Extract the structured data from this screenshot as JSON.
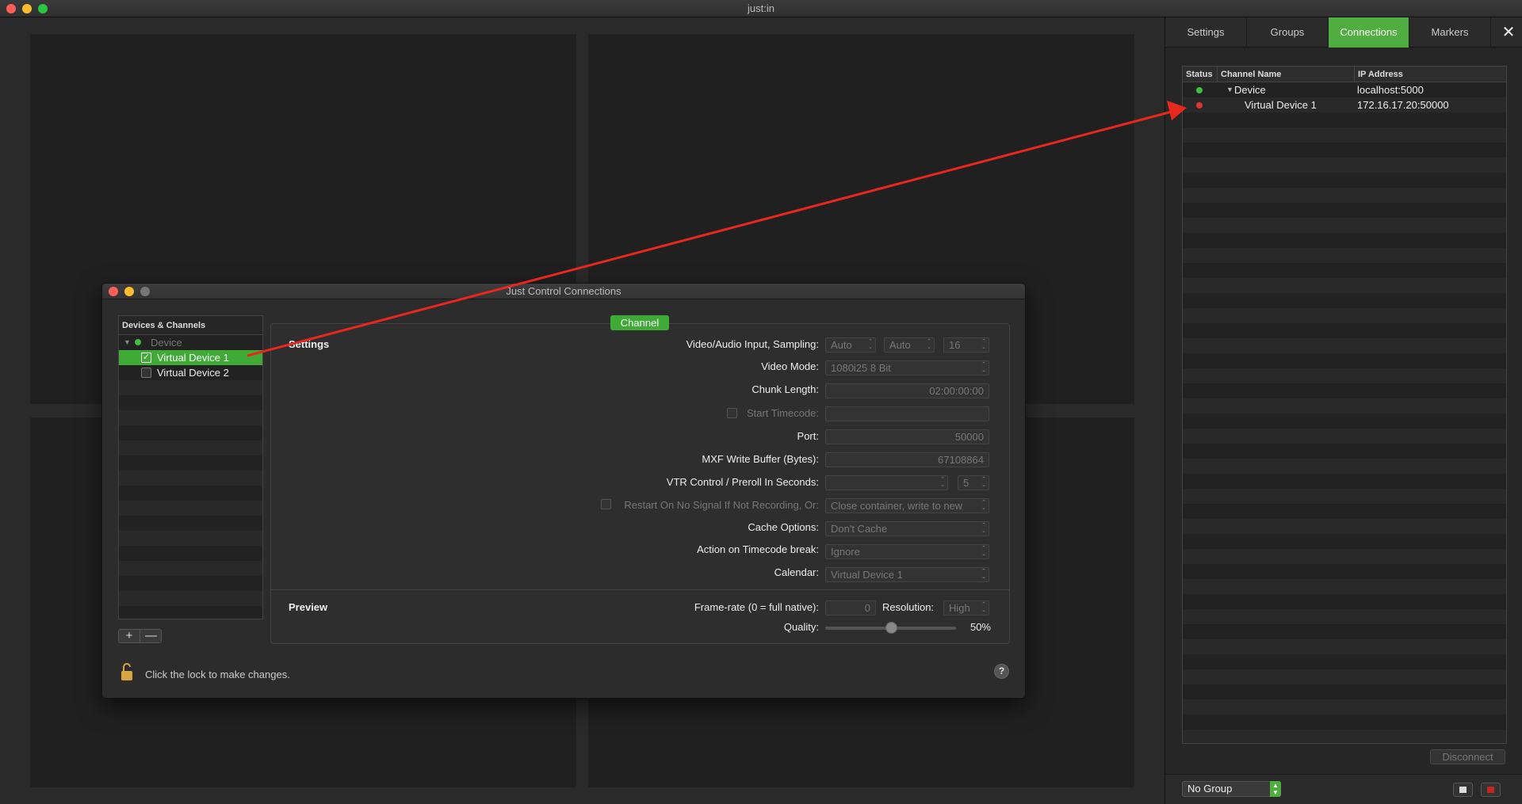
{
  "app": {
    "title": "just:in"
  },
  "side_panel": {
    "tabs": [
      {
        "label": "Settings"
      },
      {
        "label": "Groups"
      },
      {
        "label": "Connections",
        "active": true
      },
      {
        "label": "Markers"
      }
    ],
    "close_icon": "close-icon",
    "table": {
      "headers": [
        "Status",
        "Channel Name",
        "IP Address"
      ],
      "rows": [
        {
          "status": "green",
          "name": "Device",
          "ip": "localhost:5000",
          "expanded": true
        },
        {
          "status": "red",
          "name": "Virtual Device 1",
          "ip": "172.16.17.20:50000"
        }
      ]
    },
    "disconnect_label": "Disconnect",
    "group_select": "No Group"
  },
  "dialog": {
    "title": "Just Control Connections",
    "devices_header": "Devices & Channels",
    "devices": [
      {
        "label": "Device",
        "type": "group"
      },
      {
        "label": "Virtual Device 1",
        "checked": true,
        "selected": true
      },
      {
        "label": "Virtual Device 2",
        "checked": false
      }
    ],
    "add_label": "+",
    "remove_label": "—",
    "channel_tab": "Channel",
    "settings_section": "Settings",
    "preview_section": "Preview",
    "fields": {
      "video_audio_label": "Video/Audio Input, Sampling:",
      "video_audio_values": [
        "Auto",
        "Auto",
        "16"
      ],
      "video_mode_label": "Video Mode:",
      "video_mode_value": "1080i25 8 Bit",
      "chunk_length_label": "Chunk Length:",
      "chunk_length_value": "02:00:00:00",
      "start_timecode_label": "Start Timecode:",
      "port_label": "Port:",
      "port_value": "50000",
      "mxf_label": "MXF Write Buffer (Bytes):",
      "mxf_value": "67108864",
      "vtr_label": "VTR Control / Preroll In Seconds:",
      "vtr_preroll": "5",
      "restart_label": "Restart On No Signal If Not Recording, Or:",
      "restart_value": "Close container, write to new",
      "cache_label": "Cache Options:",
      "cache_value": "Don't Cache",
      "tc_break_label": "Action on Timecode break:",
      "tc_break_value": "Ignore",
      "calendar_label": "Calendar:",
      "calendar_value": "Virtual Device 1",
      "framerate_label": "Frame-rate (0 = full native):",
      "framerate_value": "0",
      "resolution_label": "Resolution:",
      "resolution_value": "High",
      "quality_label": "Quality:",
      "quality_value": "50%",
      "quality_level": 0.5
    },
    "lock_text": "Click the lock to make changes.",
    "help_label": "?"
  },
  "colors": {
    "accent": "#4fae3f",
    "status_ok": "#3fbf3f",
    "status_err": "#d83a2e",
    "arrow": "#e8281c"
  }
}
